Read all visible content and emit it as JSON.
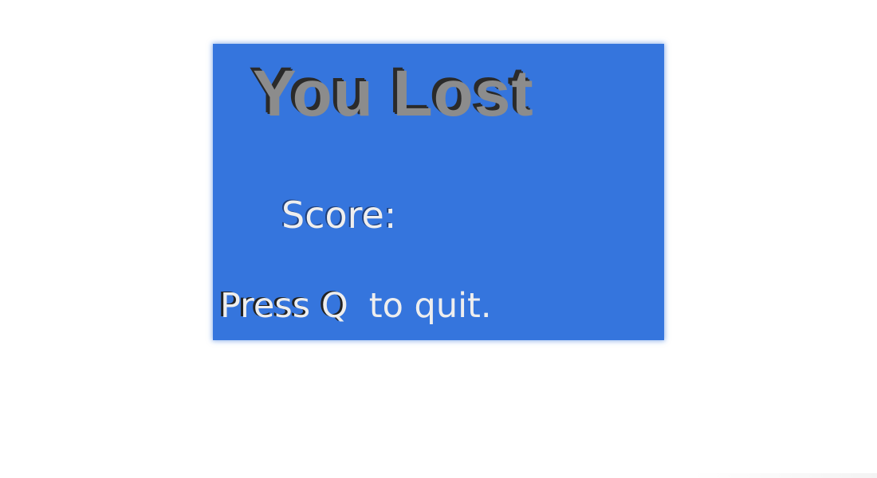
{
  "game_over": {
    "title": "You Lost",
    "score_label": "Score:",
    "score_value": "",
    "quit_prefix": "Press",
    "quit_key": "Q",
    "quit_suffix": "to quit."
  },
  "colors": {
    "panel_background": "#3575dd",
    "title_text": "#8c8c8c",
    "body_text": "#eeeeee",
    "page_background": "#ffffff"
  }
}
